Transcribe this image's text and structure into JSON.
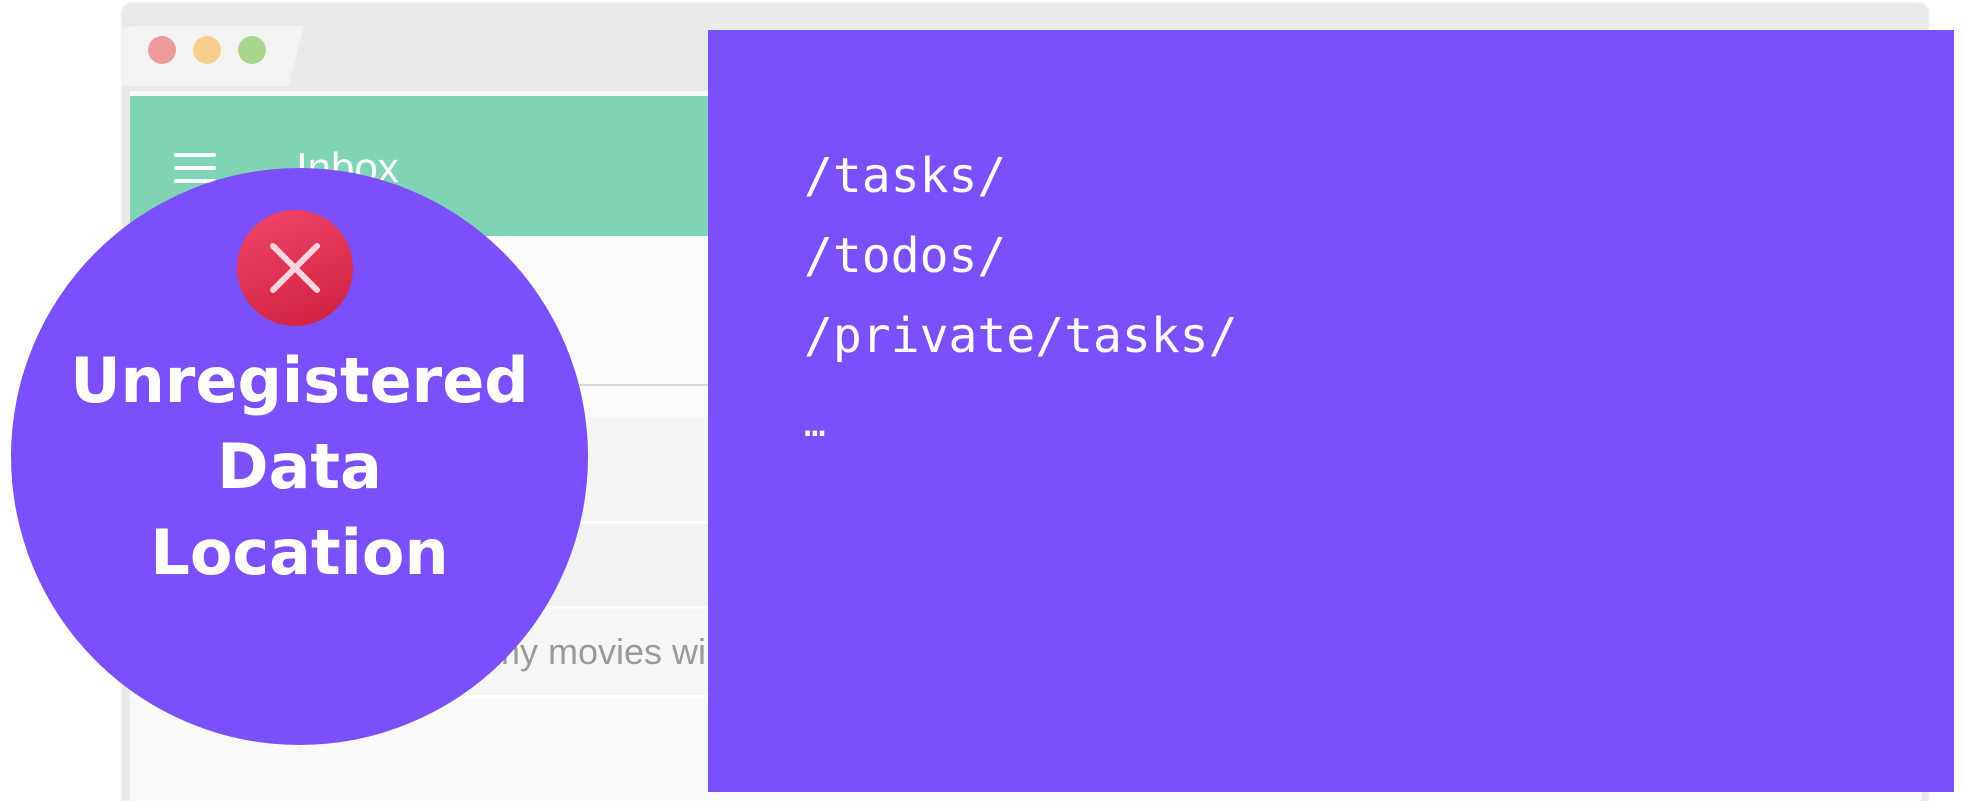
{
  "colors": {
    "accent_purple": "#7c4ffc",
    "appbar_green": "#7fd4b5",
    "window_red": "#ef9a9a",
    "window_yellow": "#f6cf8c",
    "window_green": "#a8d48d",
    "error_red": "#e0304f"
  },
  "app": {
    "title": "Inbox",
    "menu_icon": "hamburger-menu-icon",
    "list_item_text": "my movies wi"
  },
  "badge": {
    "icon": "close-icon",
    "line1": "Unregistered",
    "line2": "Data",
    "line3": "Location"
  },
  "paths": [
    "/tasks/",
    "/todos/",
    "/private/tasks/",
    "…"
  ]
}
